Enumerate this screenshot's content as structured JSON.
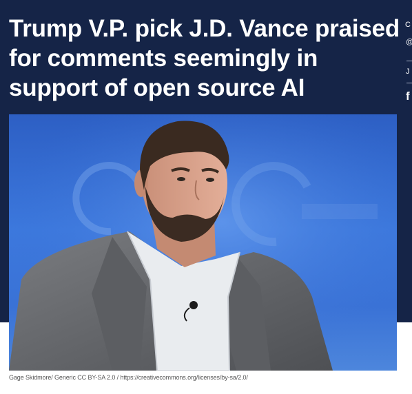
{
  "article": {
    "headline": "Trump V.P. pick J.D. Vance praised for comments seemingly in support of open source AI",
    "photo_credit": "Gage Skidmore/ Generic CC BY-SA 2.0 / https://creativecommons.org/licenses/by-sa/2.0/"
  },
  "sidebar_clipped": {
    "line1": "C",
    "line2": "@",
    "line3": "J",
    "line4": "f"
  },
  "colors": {
    "header_bg": "#152447",
    "photo_bg": "#3a72d6"
  }
}
